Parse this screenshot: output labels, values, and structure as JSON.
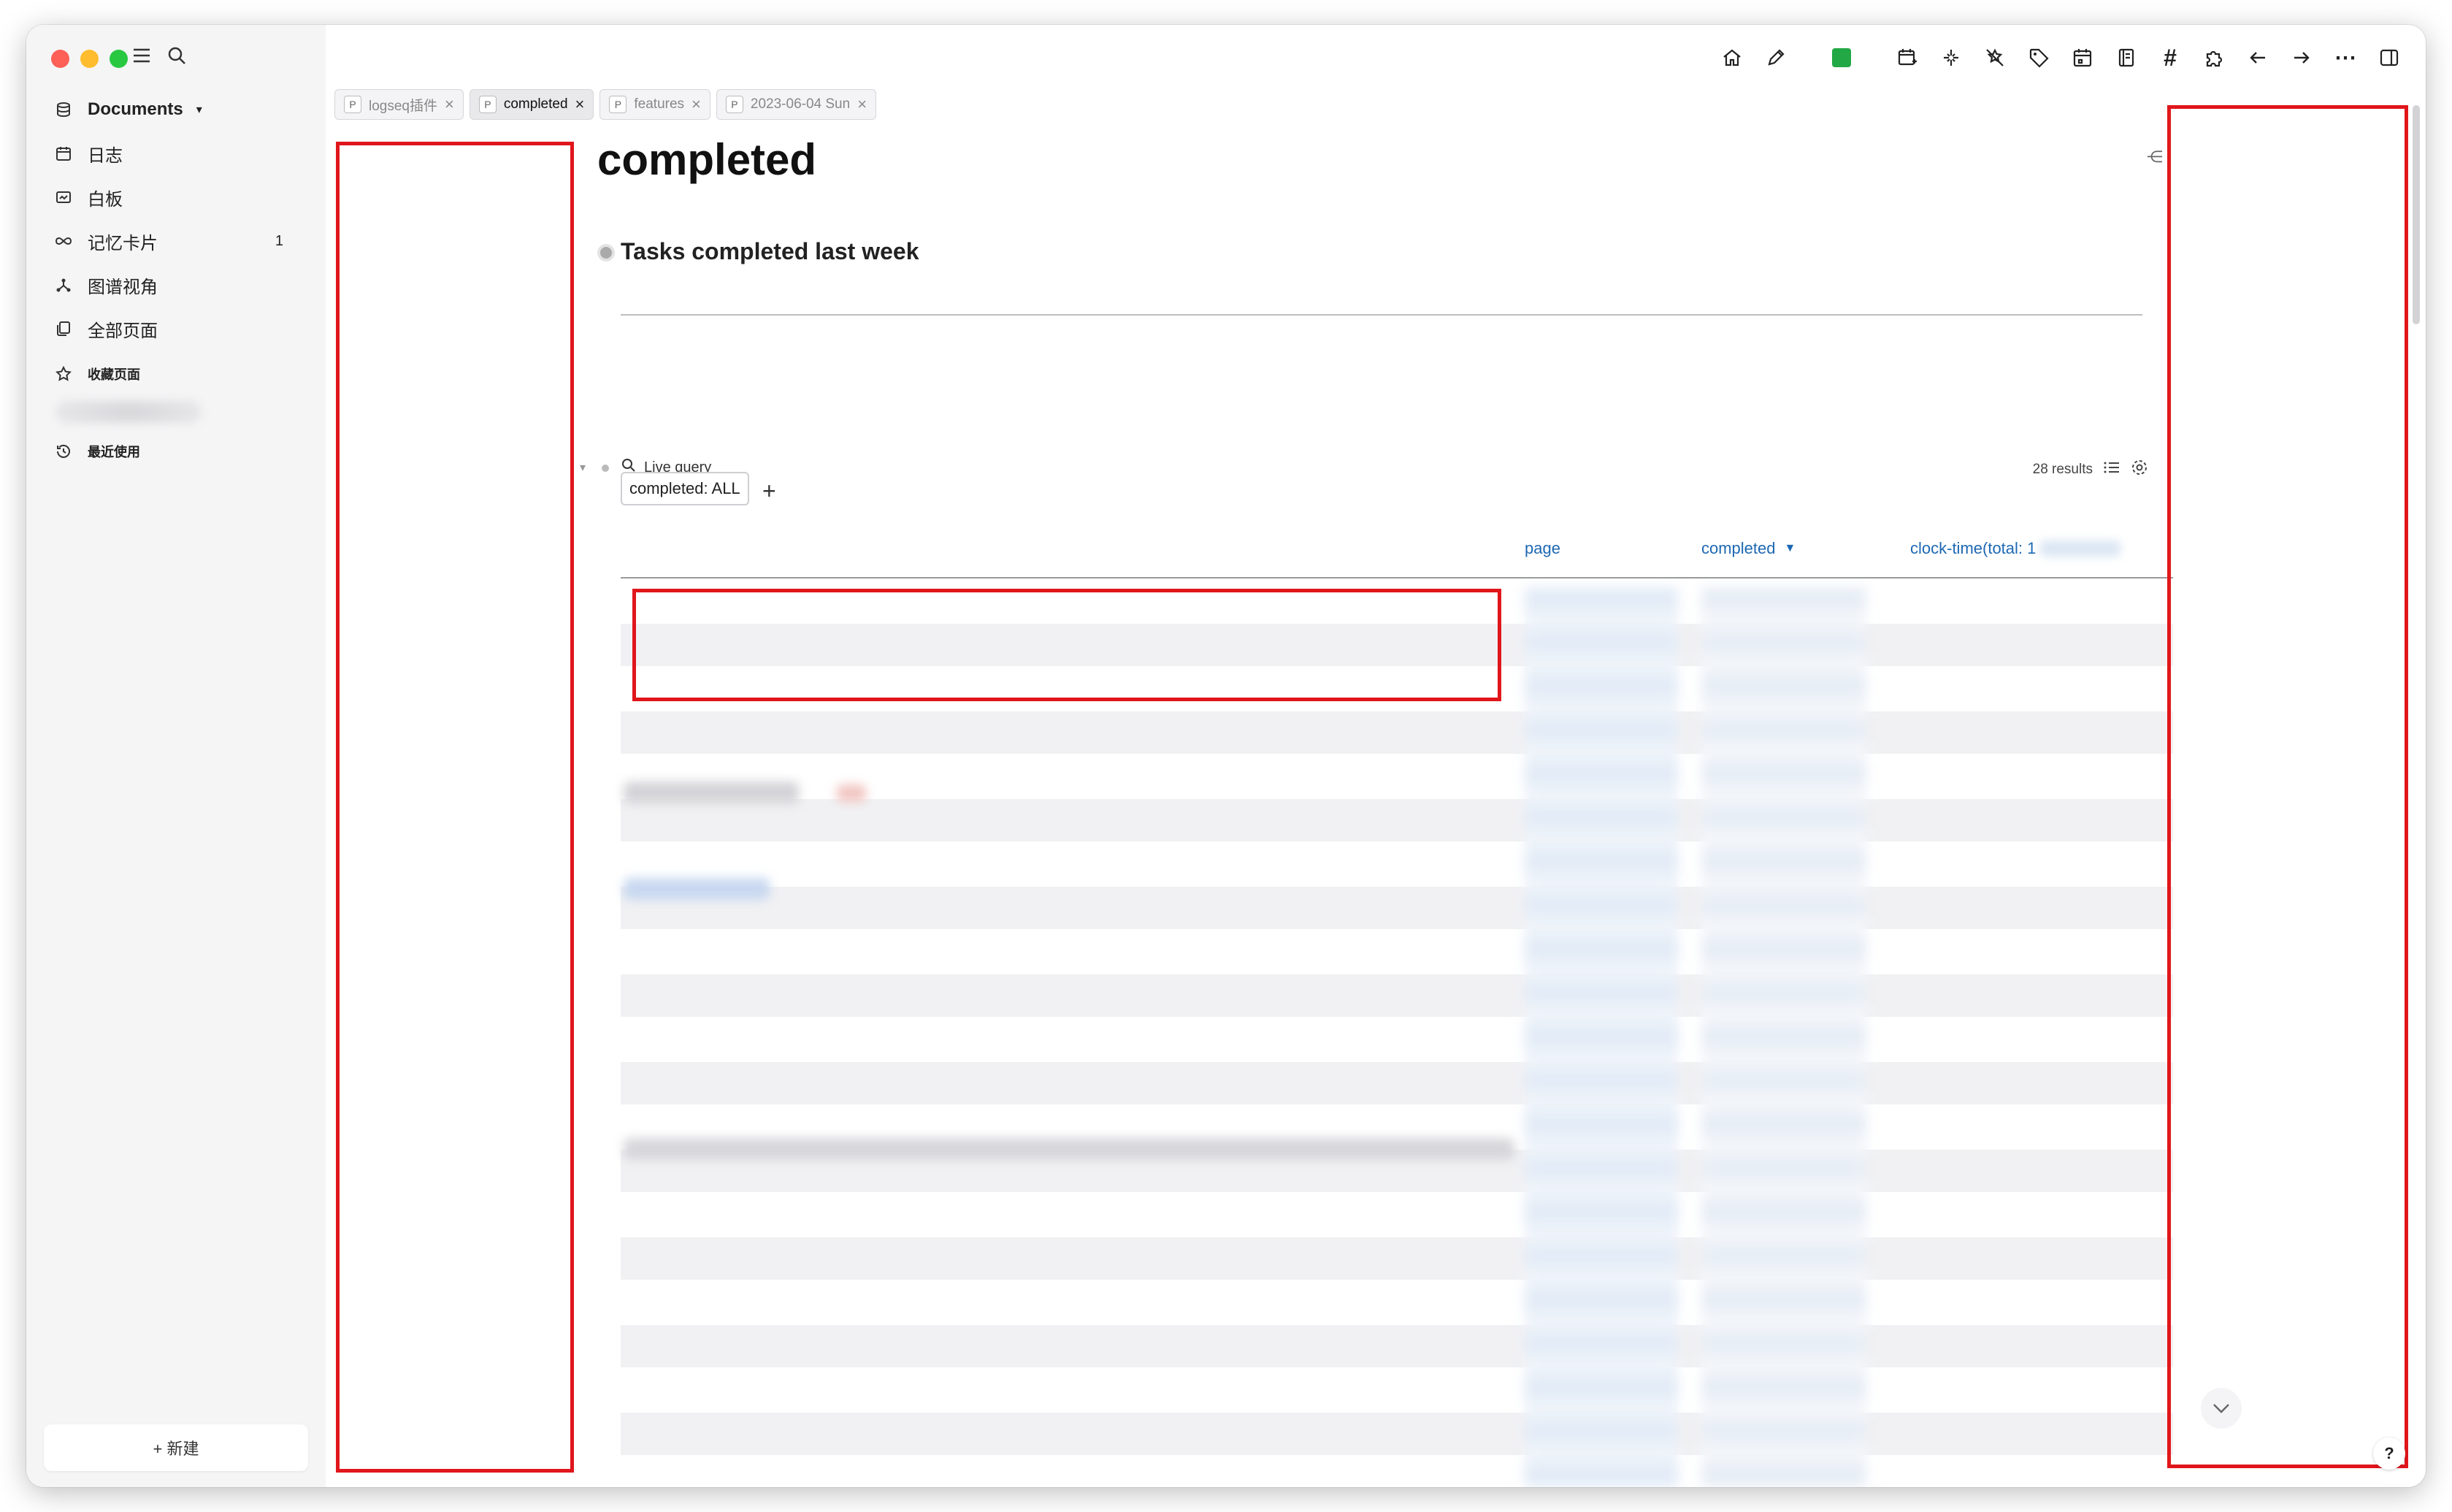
{
  "sidebar": {
    "workspace": "Documents",
    "items": [
      {
        "label": "日志",
        "icon": "calendar-icon"
      },
      {
        "label": "白板",
        "icon": "whiteboard-icon"
      },
      {
        "label": "记忆卡片",
        "icon": "infinity-icon",
        "count": "1"
      },
      {
        "label": "图谱视角",
        "icon": "graph-icon"
      },
      {
        "label": "全部页面",
        "icon": "pages-icon"
      }
    ],
    "favorites_label": "收藏页面",
    "recent_label": "最近使用",
    "new_button": "+ 新建"
  },
  "tabs": [
    {
      "prefix": "P",
      "label": "logseq插件",
      "active": false
    },
    {
      "prefix": "P",
      "label": "completed",
      "active": true
    },
    {
      "prefix": "P",
      "label": "features",
      "active": false
    },
    {
      "prefix": "P",
      "label": "2023-06-04 Sun",
      "active": false
    }
  ],
  "page": {
    "title": "completed",
    "block_heading": "Tasks completed last week",
    "query_label": "Live query",
    "results_count": "28 results",
    "filter_chip": "completed: ALL",
    "add_filter": "+",
    "columns": {
      "page": "page",
      "completed": "completed",
      "clock_time": "clock-time(total: 1"
    }
  },
  "toolbar_icons": [
    "home-icon",
    "pencil-icon",
    "status-square-icon",
    "calendar-plus-icon",
    "sparkle-icon",
    "star-remove-icon",
    "tag-icon",
    "calendar-icon",
    "book-icon",
    "hash-icon",
    "puzzle-icon",
    "back-arrow-icon",
    "forward-arrow-icon",
    "more-icon",
    "sidebar-toggle-icon"
  ],
  "help_label": "?"
}
